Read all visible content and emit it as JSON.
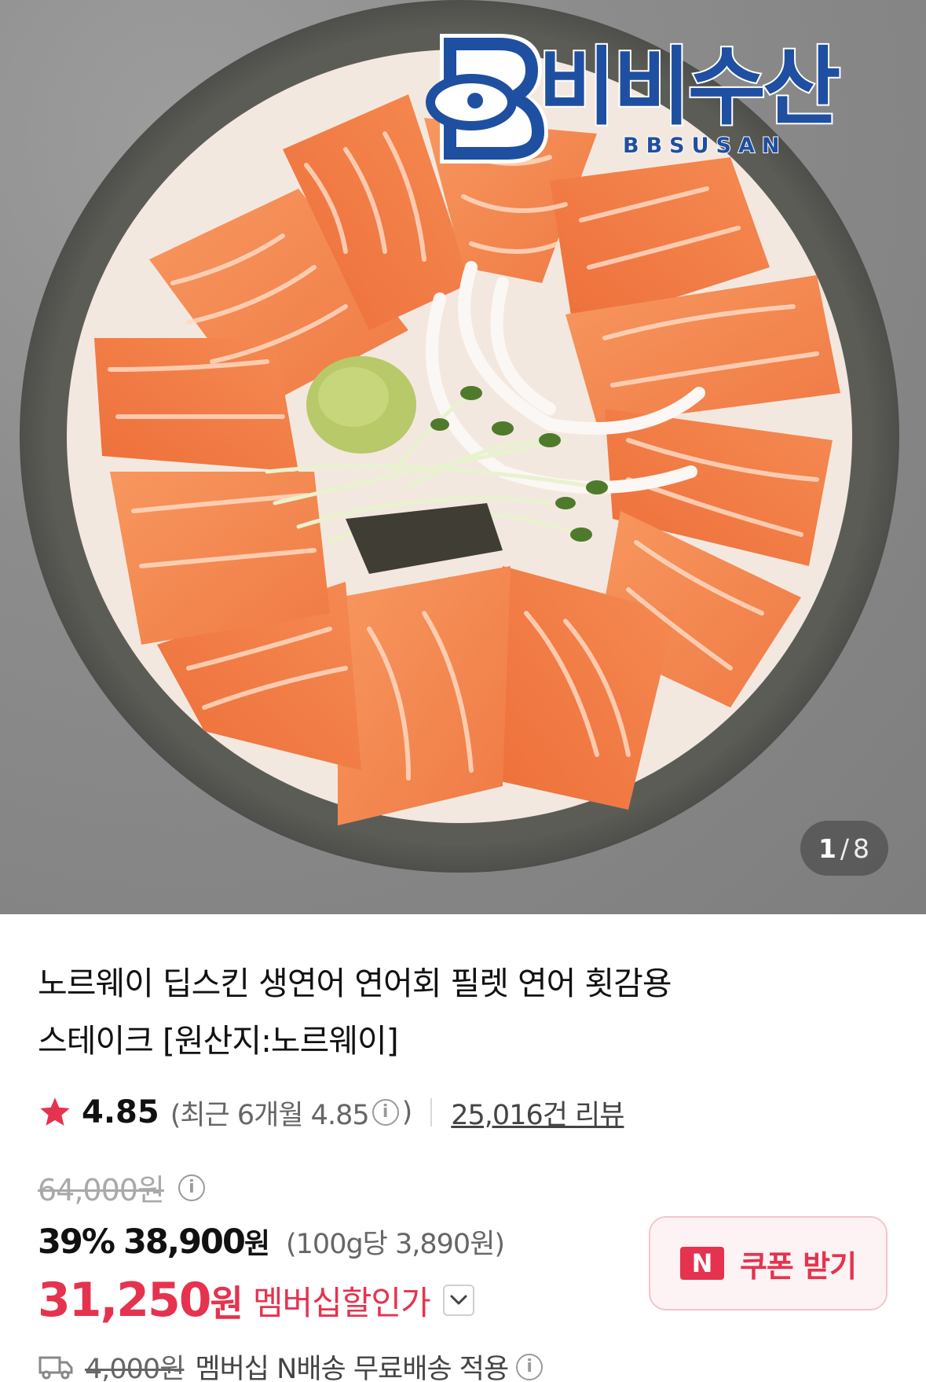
{
  "gallery": {
    "current": "1",
    "separator": "/",
    "total": "8"
  },
  "brand": {
    "name": "비비수산",
    "sub": "BBSUSAN"
  },
  "product": {
    "title_line1": "노르웨이 딥스킨 생연어 연어회 필렛 연어 횟감용",
    "title_line2": "스테이크 [원산지:노르웨이]"
  },
  "rating": {
    "score": "4.85",
    "recent": "(최근 6개월 4.85",
    "recent_close": ")",
    "reviews": "25,016건 리뷰"
  },
  "price": {
    "original": "64,000원",
    "discount": "39%",
    "sale": "38,900",
    "sale_won": "원",
    "unit": "(100g당 3,890원)",
    "member": "31,250",
    "member_won": "원",
    "member_label": "멤버십할인가"
  },
  "coupon": {
    "badge": "N",
    "label": "쿠폰 받기"
  },
  "shipping": {
    "fee": "4,000원",
    "text": "멤버십 N배송 무료배송 적용"
  },
  "icons": {
    "info": "i",
    "star": "star-icon",
    "truck": "truck-icon",
    "chevron": "chevron-down-icon"
  },
  "colors": {
    "accent": "#e5334f",
    "brand_blue": "#1f4fa0"
  }
}
